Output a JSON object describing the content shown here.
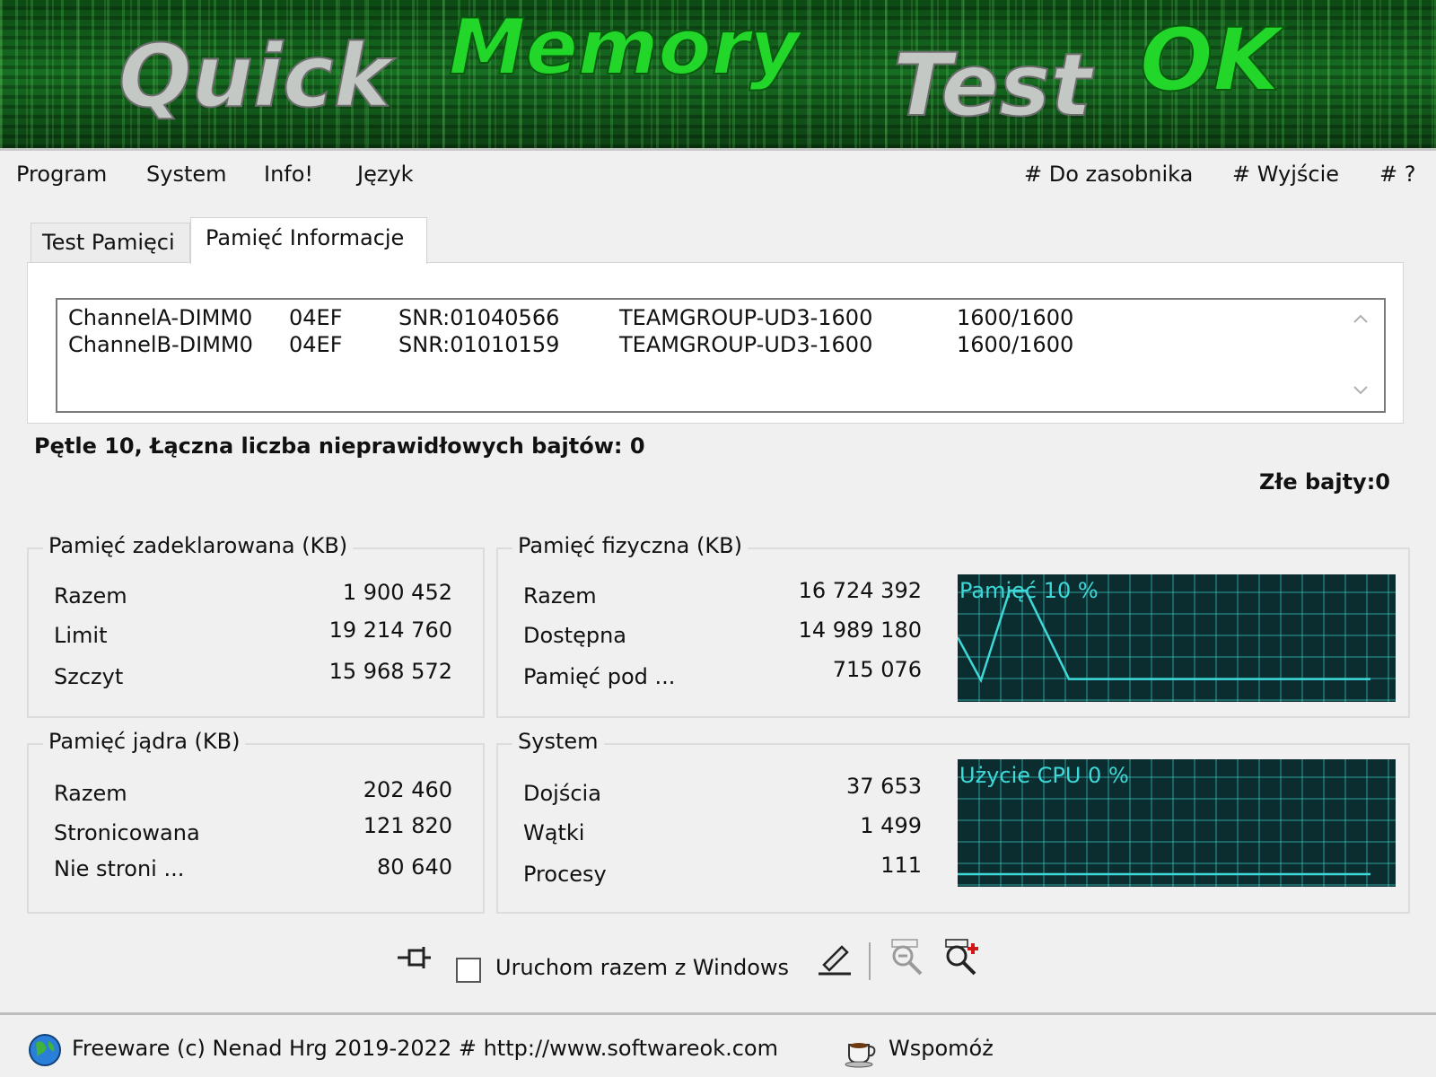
{
  "banner": {
    "word1": "Quick",
    "word2": "Memory",
    "word3": "Test",
    "word4": "OK"
  },
  "menu": {
    "left": [
      "Program",
      "System",
      "Info!",
      "Język"
    ],
    "right": [
      "# Do zasobnika",
      "# Wyjście",
      "# ?"
    ]
  },
  "tabs": {
    "test": "Test Pamięci",
    "info": "Pamięć Informacje"
  },
  "modules": [
    {
      "slot": "ChannelA-DIMM0",
      "vendor": "04EF",
      "serial": "SNR:01040566",
      "part": "TEAMGROUP-UD3-1600",
      "speed": "1600/1600"
    },
    {
      "slot": "ChannelB-DIMM0",
      "vendor": "04EF",
      "serial": "SNR:01010159",
      "part": "TEAMGROUP-UD3-1600",
      "speed": "1600/1600"
    }
  ],
  "status": {
    "loops": "Pętle 10, Łączna liczba nieprawidłowych bajtów: 0",
    "bad_bytes": "Złe bajty:0"
  },
  "committed": {
    "title": "Pamięć zadeklarowana (KB)",
    "rows": [
      {
        "label": "Razem",
        "value": "1 900 452"
      },
      {
        "label": "Limit",
        "value": "19 214 760"
      },
      {
        "label": "Szczyt",
        "value": "15 968 572"
      }
    ]
  },
  "physical": {
    "title": "Pamięć fizyczna (KB)",
    "rows": [
      {
        "label": "Razem",
        "value": "16 724 392"
      },
      {
        "label": "Dostępna",
        "value": "14 989 180"
      },
      {
        "label": "Pamięć pod ...",
        "value": "715 076"
      }
    ],
    "graph_label": "Pamięć 10 %",
    "usage_percent": 10
  },
  "kernel": {
    "title": "Pamięć jądra (KB)",
    "rows": [
      {
        "label": "Razem",
        "value": "202 460"
      },
      {
        "label": "Stronicowana",
        "value": "121 820"
      },
      {
        "label": "Nie stroni ...",
        "value": "80 640"
      }
    ]
  },
  "system": {
    "title": "System",
    "rows": [
      {
        "label": "Dojścia",
        "value": "37 653"
      },
      {
        "label": "Wątki",
        "value": "1 499"
      },
      {
        "label": "Procesy",
        "value": "111"
      }
    ],
    "graph_label": "Użycie CPU 0 %",
    "cpu_percent": 0
  },
  "toolbar": {
    "autostart_label": "Uruchom razem z Windows",
    "autostart_checked": false,
    "icons": [
      "pin-icon",
      "edit-icon",
      "zoom-out-icon",
      "zoom-in-icon"
    ]
  },
  "footer": {
    "text": "Freeware (c) Nenad Hrg 2019-2022 # http://www.softwareok.com",
    "donate": "Wspomóż"
  },
  "colors": {
    "graph_bg": "#0b2d2f",
    "graph_line": "#3fd8d8",
    "banner_green": "#22d62a"
  }
}
